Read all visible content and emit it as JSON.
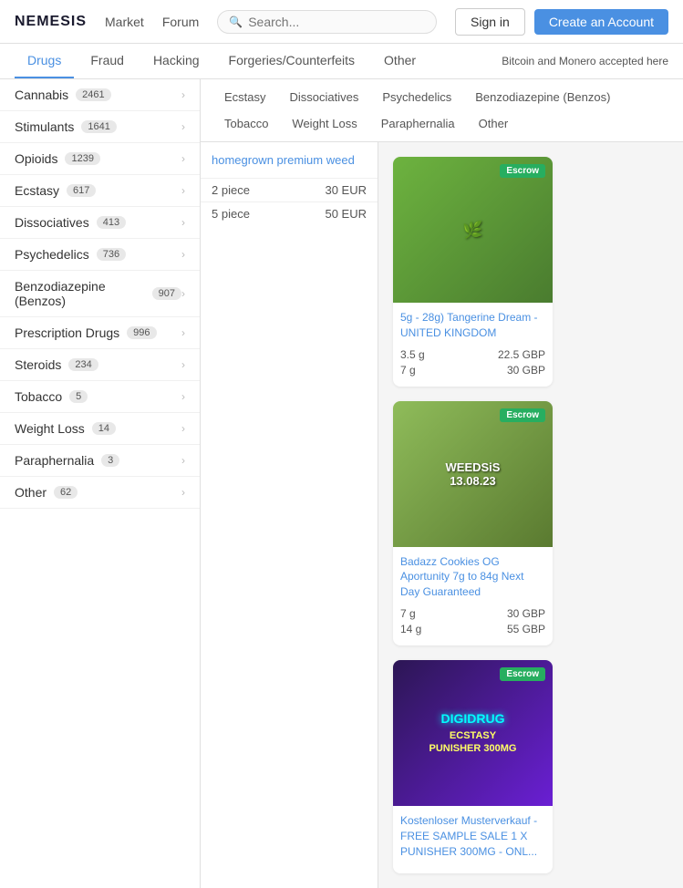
{
  "header": {
    "logo": "NEMESIS",
    "nav": [
      "Market",
      "Forum"
    ],
    "search_placeholder": "Search...",
    "sign_in_label": "Sign in",
    "create_account_label": "Create an Account"
  },
  "top_tabs": {
    "items": [
      "Drugs",
      "Fraud",
      "Hacking",
      "Forgeries/Counterfeits",
      "Other"
    ],
    "active": "Drugs",
    "note": "Bitcoin and Monero accepted here"
  },
  "sidebar": {
    "items": [
      {
        "label": "Cannabis",
        "count": "2461"
      },
      {
        "label": "Stimulants",
        "count": "1641"
      },
      {
        "label": "Opioids",
        "count": "1239"
      },
      {
        "label": "Ecstasy",
        "count": "617"
      },
      {
        "label": "Dissociatives",
        "count": "413"
      },
      {
        "label": "Psychedelics",
        "count": "736"
      },
      {
        "label": "Benzodiazepine (Benzos)",
        "count": "907"
      },
      {
        "label": "Prescription Drugs",
        "count": "996"
      },
      {
        "label": "Steroids",
        "count": "234"
      },
      {
        "label": "Tobacco",
        "count": "5"
      },
      {
        "label": "Weight Loss",
        "count": "14"
      },
      {
        "label": "Paraphernalia",
        "count": "3"
      },
      {
        "label": "Other",
        "count": "62"
      }
    ]
  },
  "sub_tabs": {
    "items": [
      "Ecstasy",
      "Dissociatives",
      "Psychedelics",
      "Benzodiazepine (Benzos)",
      "Tobacco",
      "Weight Loss",
      "Paraphernalia",
      "Other"
    ]
  },
  "left_product": {
    "title": "homegrown premium weed",
    "rows": [
      {
        "qty": "2 piece",
        "price": "30 EUR"
      },
      {
        "qty": "5 piece",
        "price": "50 EUR"
      }
    ]
  },
  "products": [
    {
      "title": "5g - 28g) Tangerine Dream - UNITED KINGDOM",
      "escrow": "Escrow",
      "rows": [
        {
          "qty": "3.5 g",
          "price": "22.5 GBP"
        },
        {
          "qty": "7 g",
          "price": "30 GBP"
        }
      ],
      "img_type": "cannabis"
    },
    {
      "title": "Badazz Cookies OG Aportunity 7g to 84g Next Day Guaranteed",
      "escrow": "Escrow",
      "rows": [
        {
          "qty": "7 g",
          "price": "30 GBP"
        },
        {
          "qty": "14 g",
          "price": "55 GBP"
        }
      ],
      "img_type": "weed"
    },
    {
      "title": "Kostenloser Musterverkauf - FREE SAMPLE SALE 1 X PUNISHER 300MG - ONL...",
      "escrow": "Escrow",
      "rows": [],
      "img_type": "ecstasy"
    }
  ]
}
